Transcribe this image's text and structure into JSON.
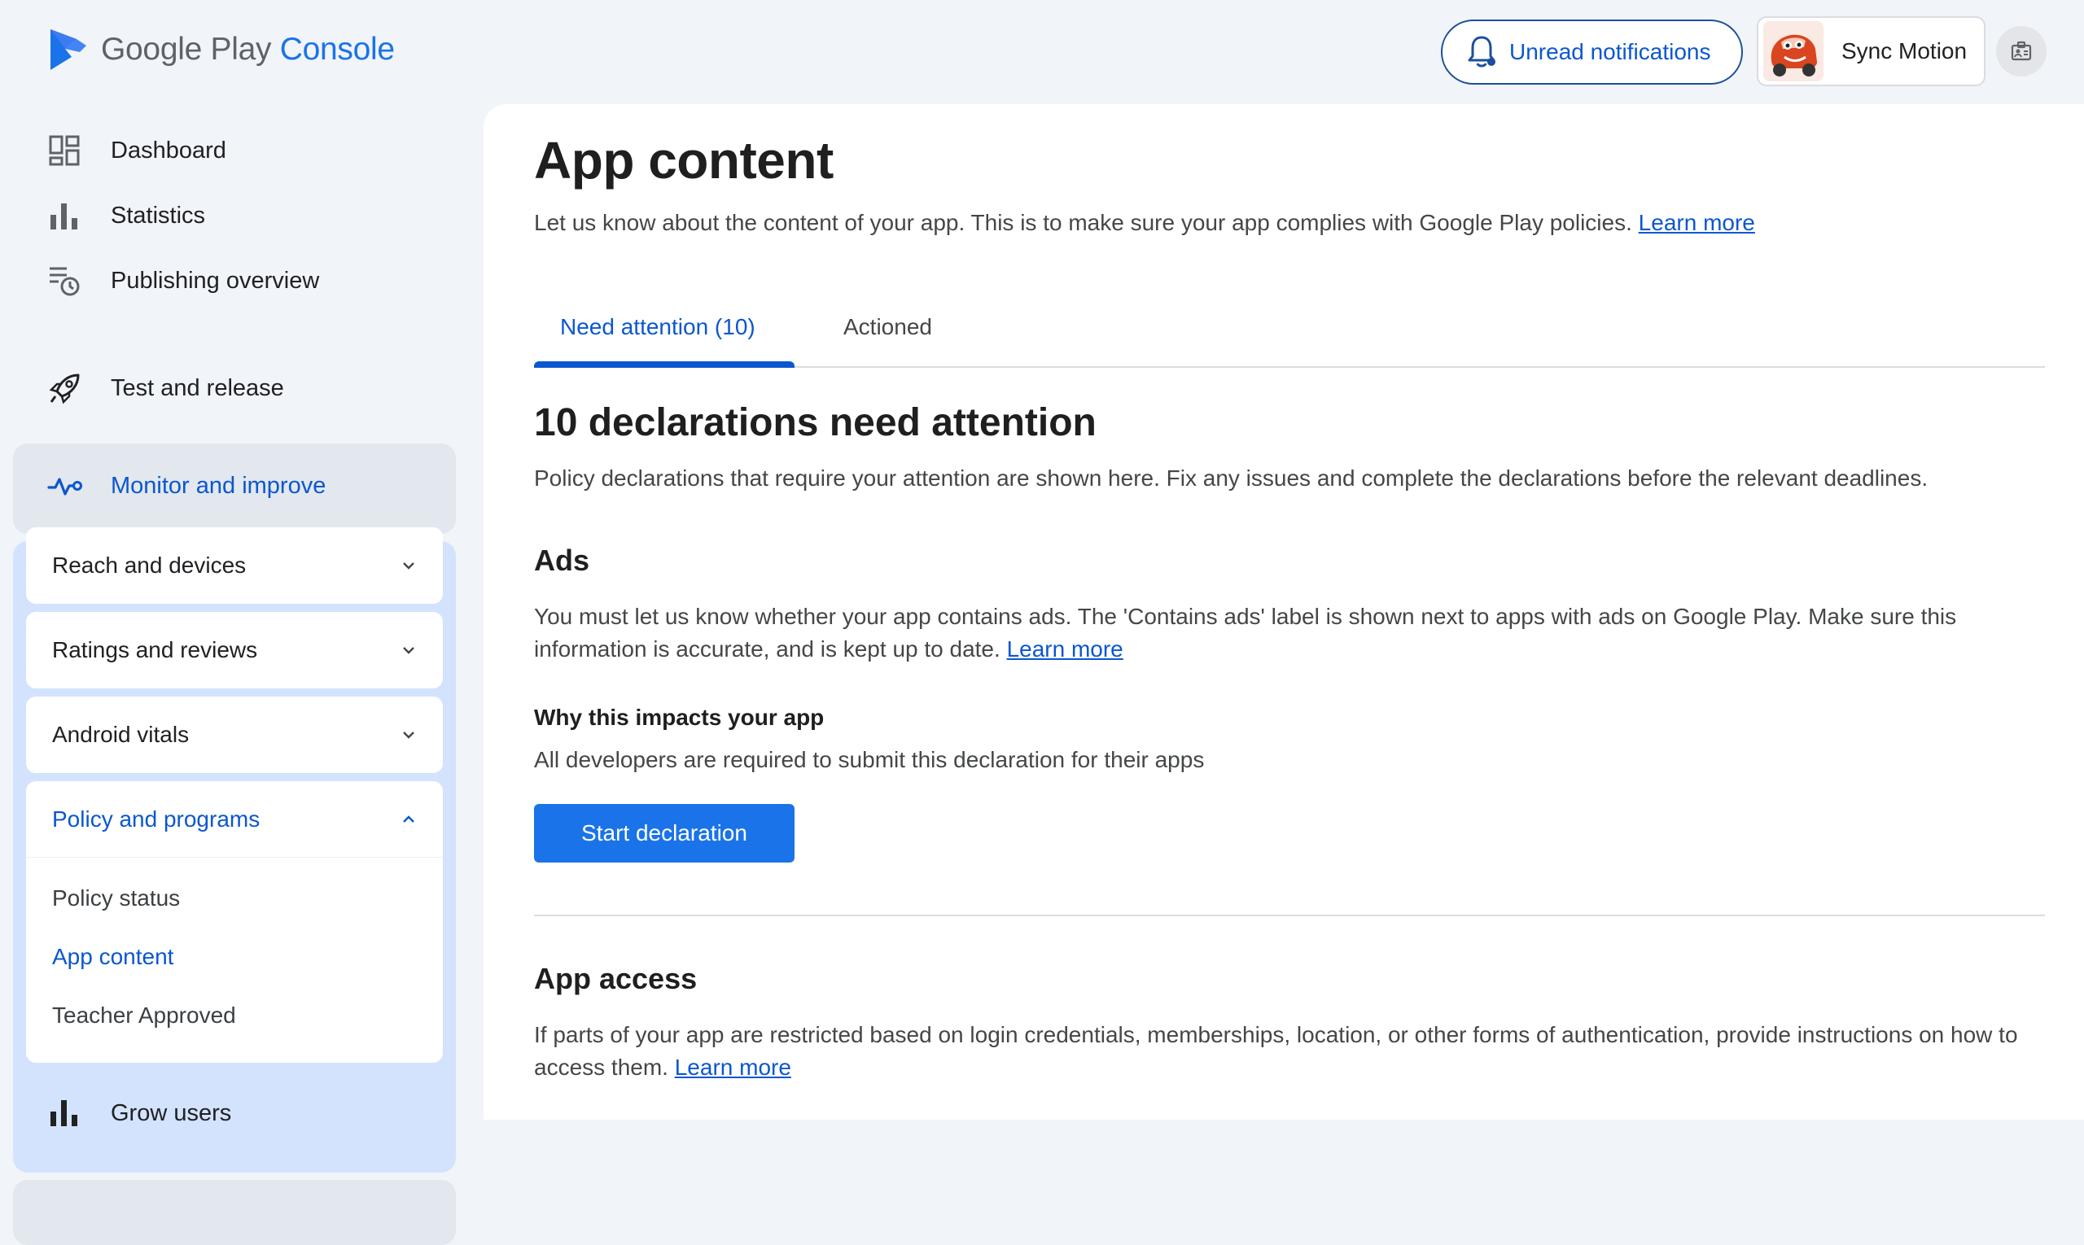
{
  "header": {
    "brand_google_play": "Google Play",
    "brand_console": "Console",
    "notifications_label": "Unread notifications",
    "account_name": "Sync Motion"
  },
  "sidebar": {
    "items": [
      {
        "label": "Dashboard",
        "icon": "dashboard-icon"
      },
      {
        "label": "Statistics",
        "icon": "bar-chart-icon"
      },
      {
        "label": "Publishing overview",
        "icon": "publishing-icon"
      }
    ],
    "test_release": {
      "label": "Test and release",
      "icon": "rocket-icon"
    },
    "monitor": {
      "label": "Monitor and improve",
      "icon": "pulse-icon",
      "groups": [
        {
          "label": "Reach and devices",
          "expanded": false
        },
        {
          "label": "Ratings and reviews",
          "expanded": false
        },
        {
          "label": "Android vitals",
          "expanded": false
        },
        {
          "label": "Policy and programs",
          "expanded": true
        }
      ],
      "policy_links": [
        {
          "label": "Policy status",
          "active": false
        },
        {
          "label": "App content",
          "active": true
        },
        {
          "label": "Teacher Approved",
          "active": false
        }
      ]
    },
    "grow": {
      "label": "Grow users",
      "icon": "bar-chart-icon"
    }
  },
  "main": {
    "title": "App content",
    "description": "Let us know about the content of your app. This is to make sure your app complies with Google Play policies.",
    "learn_more": "Learn more",
    "tabs": [
      {
        "label": "Need attention (10)",
        "active": true
      },
      {
        "label": "Actioned",
        "active": false
      }
    ],
    "declarations_heading": "10 declarations need attention",
    "declarations_desc": "Policy declarations that require your attention are shown here. Fix any issues and complete the declarations before the relevant deadlines.",
    "ads": {
      "title": "Ads",
      "desc": "You must let us know whether your app contains ads. The 'Contains ads' label is shown next to apps with ads on Google Play. Make sure this information is accurate, and is kept up to date.",
      "learn_more": "Learn more",
      "why_title": "Why this impacts your app",
      "why_desc": "All developers are required to submit this declaration for their apps",
      "button": "Start declaration"
    },
    "app_access": {
      "title": "App access",
      "desc": "If parts of your app are restricted based on login credentials, memberships, location, or other forms of authentication, provide instructions on how to access them.",
      "learn_more": "Learn more"
    }
  },
  "colors": {
    "accent": "#0b57d0",
    "button": "#1a73e8",
    "sidebar_active_bg": "#d3e3fd",
    "page_bg": "#f1f4f9"
  }
}
